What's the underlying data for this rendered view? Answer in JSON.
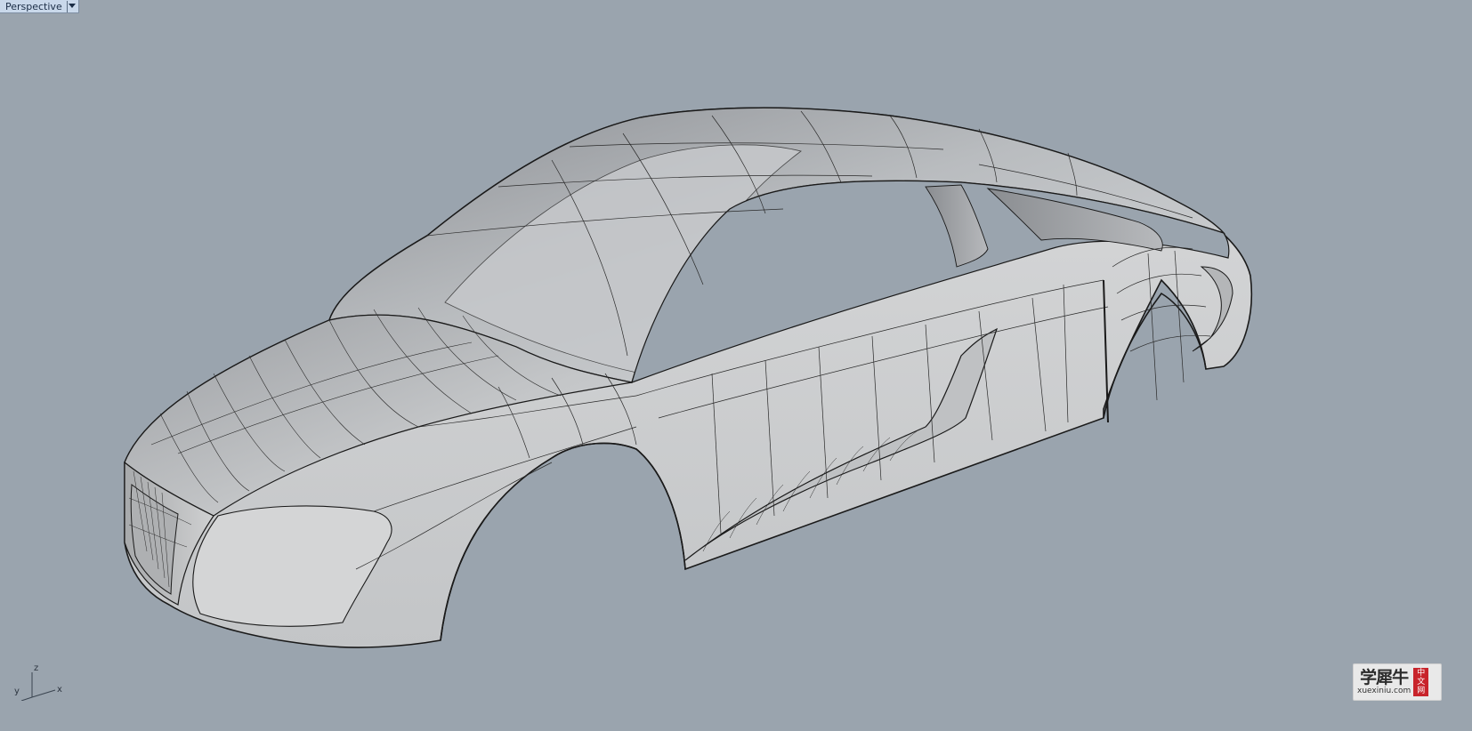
{
  "viewport": {
    "name": "Perspective",
    "background_color": "#9aa4ae",
    "dropdown_icon": "triangle-down"
  },
  "axes": {
    "x": "x",
    "y": "y",
    "z": "z"
  },
  "watermark": {
    "cn_text": "学犀牛",
    "url": "xuexiniu.com",
    "seal_chars": [
      "中",
      "文",
      "网"
    ],
    "seal_color": "#c8242b"
  },
  "model": {
    "surface_color": "#c9cbcd",
    "edge_color": "#1a1a1a"
  }
}
